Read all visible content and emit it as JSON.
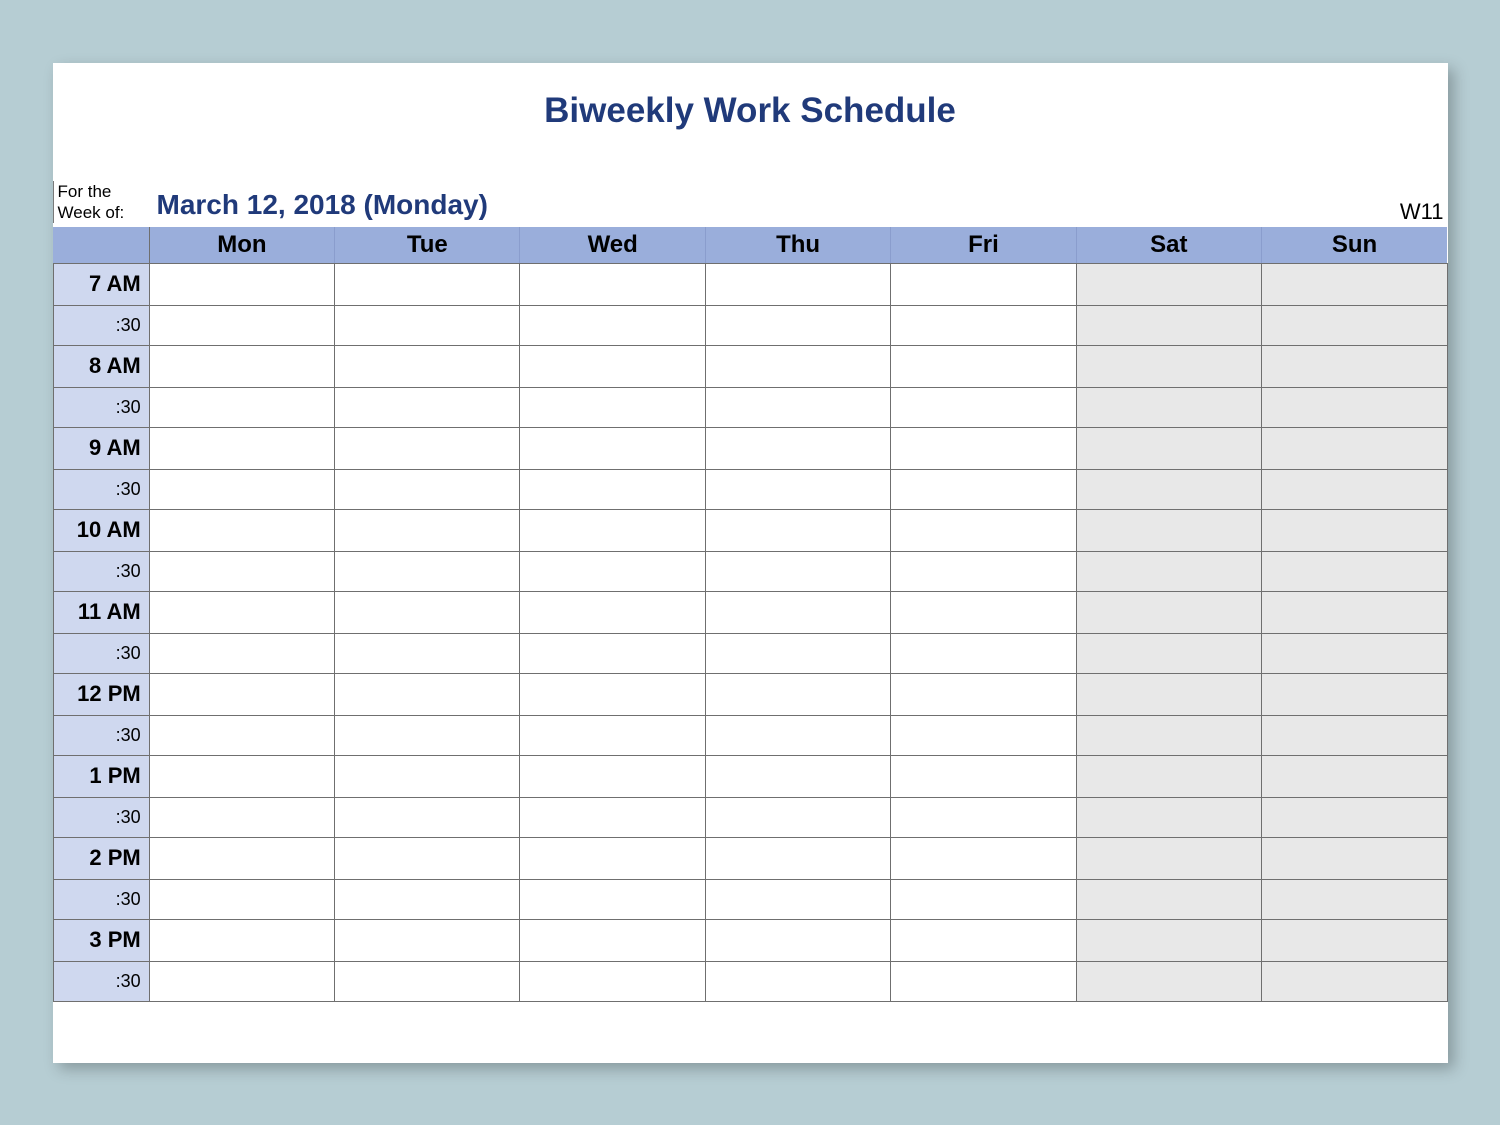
{
  "title": "Biweekly Work Schedule",
  "for_week_label": "For the Week of:",
  "week_date": "March 12, 2018 (Monday)",
  "week_number": "W11",
  "days": [
    "Mon",
    "Tue",
    "Wed",
    "Thu",
    "Fri",
    "Sat",
    "Sun"
  ],
  "weekend_indices": [
    5,
    6
  ],
  "hours": [
    "7 AM",
    "8 AM",
    "9 AM",
    "10 AM",
    "11 AM",
    "12 PM",
    "1 PM",
    "2 PM",
    "3 PM"
  ],
  "half_mark": ":30"
}
